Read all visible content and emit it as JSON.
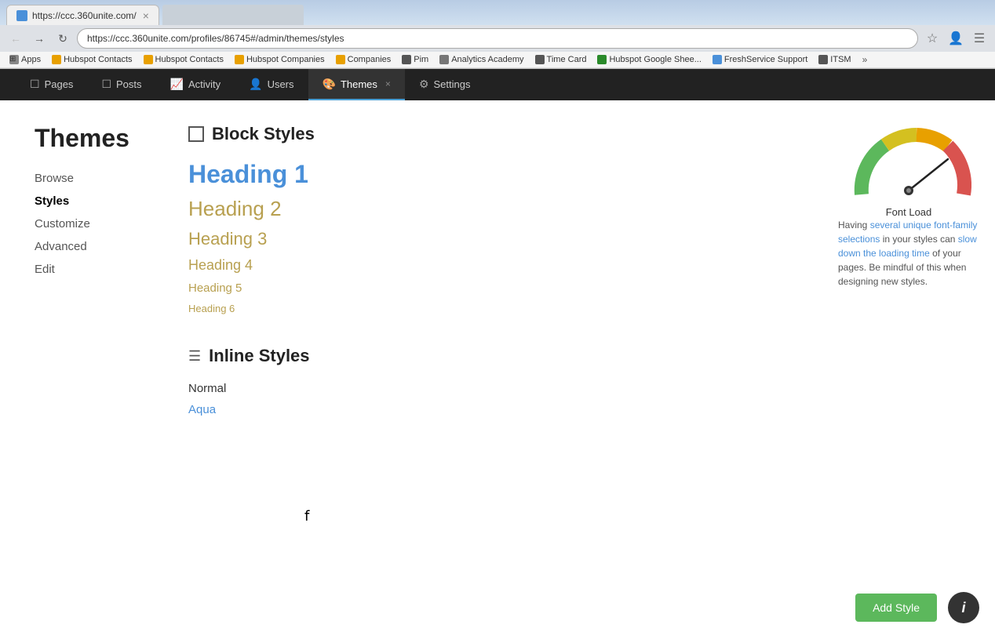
{
  "browser": {
    "tab_title": "https://ccc.360unite.com/",
    "tab_close": "×",
    "address": "https://ccc.360unite.com/profiles/86745#/admin/themes/styles",
    "nav_back": "←",
    "nav_forward": "→",
    "nav_refresh": "↻"
  },
  "bookmarks": [
    {
      "label": "Apps",
      "type": "apps"
    },
    {
      "label": "Hubspot Contacts",
      "color": "#e8a000"
    },
    {
      "label": "Hubspot Contacts",
      "color": "#e8a000"
    },
    {
      "label": "Hubspot Companies",
      "color": "#e8a000"
    },
    {
      "label": "Companies",
      "color": "#e8a000"
    },
    {
      "label": "Pim",
      "color": "#555"
    },
    {
      "label": "Analytics Academy",
      "color": "#777"
    },
    {
      "label": "Time Card",
      "color": "#555"
    },
    {
      "label": "Hubspot Google Shee...",
      "color": "#2a8a2a"
    },
    {
      "label": "FreshService Support",
      "color": "#4a90d9"
    },
    {
      "label": "ITSM",
      "color": "#555"
    }
  ],
  "app_nav": {
    "items": [
      {
        "label": "Pages",
        "icon": "📄",
        "active": false
      },
      {
        "label": "Posts",
        "icon": "📋",
        "active": false
      },
      {
        "label": "Activity",
        "icon": "📈",
        "active": false
      },
      {
        "label": "Users",
        "icon": "👤",
        "active": false
      },
      {
        "label": "Themes",
        "icon": "🎨",
        "active": true,
        "closable": true
      },
      {
        "label": "Settings",
        "icon": "⚙",
        "active": false
      }
    ]
  },
  "sidebar": {
    "title": "Themes",
    "links": [
      {
        "label": "Browse",
        "active": false
      },
      {
        "label": "Styles",
        "active": true
      },
      {
        "label": "Customize",
        "active": false
      },
      {
        "label": "Advanced",
        "active": false
      },
      {
        "label": "Edit",
        "active": false
      }
    ]
  },
  "main": {
    "block_styles": {
      "section_title": "Block Styles",
      "headings": [
        {
          "label": "Heading 1",
          "class": "h1-preview"
        },
        {
          "label": "Heading 2",
          "class": "h2-preview"
        },
        {
          "label": "Heading 3",
          "class": "h3-preview"
        },
        {
          "label": "Heading 4",
          "class": "h4-preview"
        },
        {
          "label": "Heading 5",
          "class": "h5-preview"
        },
        {
          "label": "Heading 6",
          "class": "h6-preview"
        }
      ]
    },
    "inline_styles": {
      "section_title": "Inline Styles",
      "items": [
        {
          "label": "Normal"
        },
        {
          "label": "Aqua"
        }
      ]
    }
  },
  "font_load": {
    "title": "Font Load",
    "description_parts": [
      {
        "text": "Having ",
        "highlight": false
      },
      {
        "text": "several unique font-family selections",
        "highlight": true
      },
      {
        "text": " in your styles can ",
        "highlight": false
      },
      {
        "text": "slow down the loading time",
        "highlight": true
      },
      {
        "text": " of your pages. Be mindful of this when designing new styles.",
        "highlight": false
      }
    ]
  },
  "buttons": {
    "add_style": "Add Style",
    "info": "i"
  }
}
